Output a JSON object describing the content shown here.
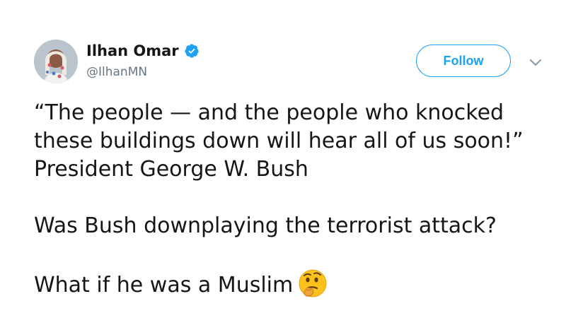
{
  "tweet": {
    "author_name": "Ilhan Omar",
    "author_handle": "@IlhanMN",
    "verified_icon": "verified-badge-icon",
    "follow_label": "Follow",
    "caret_icon": "chevron-down-icon",
    "text_lines": [
      "“The people — and the people who knocked",
      "these buildings down will hear all of us soon!”",
      "President George W. Bush"
    ],
    "question_line": "Was Bush downplaying the terrorist attack?",
    "last_line": "What if he was a Muslim",
    "emoji": "thinking-face-emoji"
  },
  "colors": {
    "accent": "#1da1f2",
    "text": "#14171a",
    "secondary_text": "#657786"
  }
}
